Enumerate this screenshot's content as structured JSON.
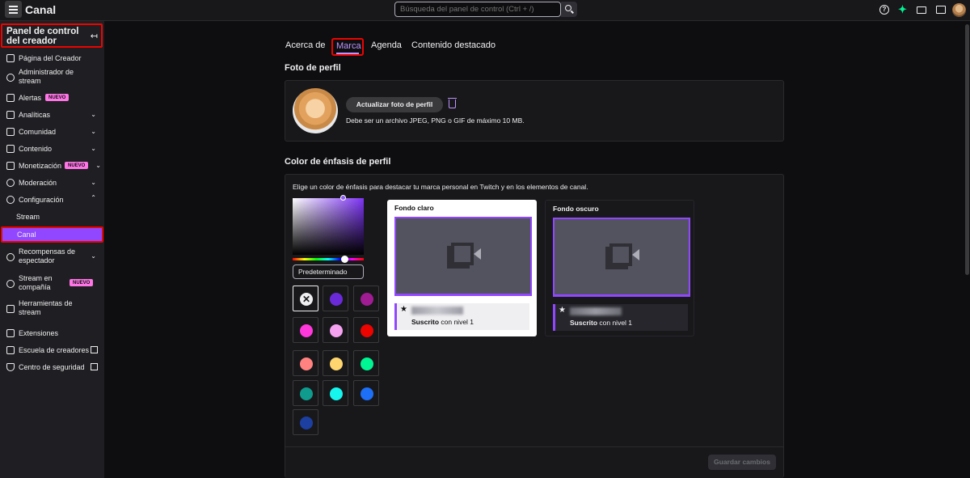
{
  "topbar": {
    "title": "Canal",
    "search_placeholder": "Búsqueda del panel de control (Ctrl + /)",
    "icons": [
      "help-icon",
      "sparkle-icon",
      "inbox-icon",
      "whispers-icon",
      "avatar"
    ]
  },
  "sidebar": {
    "header": "Panel de control del creador",
    "items": [
      {
        "label": "Página del Creador"
      },
      {
        "label": "Administrador de stream"
      },
      {
        "label": "Alertas",
        "badge": "NUEVO"
      },
      {
        "label": "Analíticas"
      },
      {
        "label": "Comunidad"
      },
      {
        "label": "Contenido"
      },
      {
        "label": "Monetización",
        "badge": "NUEVO"
      },
      {
        "label": "Moderación"
      },
      {
        "label": "Configuración"
      },
      {
        "label": "Stream"
      },
      {
        "label": "Canal"
      },
      {
        "label": "Recompensas de espectador"
      },
      {
        "label": "Stream en compañía",
        "badge": "NUEVO"
      },
      {
        "label": "Herramientas de stream"
      },
      {
        "label": "Extensiones"
      },
      {
        "label": "Escuela de creadores"
      },
      {
        "label": "Centro de seguridad"
      }
    ]
  },
  "tabs": [
    "Acerca de",
    "Marca",
    "Agenda",
    "Contenido destacado"
  ],
  "active_tab": "Marca",
  "profile_photo": {
    "title": "Foto de perfil",
    "button": "Actualizar foto de perfil",
    "hint": "Debe ser un archivo JPEG, PNG o GIF de máximo 10 MB."
  },
  "accent": {
    "title": "Color de énfasis de perfil",
    "description": "Elige un color de énfasis para destacar tu marca personal en Twitch y en los elementos de canal.",
    "default_label": "Predeterminado",
    "selected_color": "#7d34f5",
    "swatches": [
      "none",
      "#6b2ad8",
      "#a01c93",
      "#ff38db",
      "#f5a3f0",
      "#eb0400",
      "#ff8280",
      "#fed56e",
      "#00f593",
      "#0f9b8e",
      "#16f5ee",
      "#1d6ff5",
      "#1c3fa0"
    ],
    "light_preview": {
      "title": "Fondo claro",
      "sub_label": "Suscrito",
      "sub_level": "con nivel 1"
    },
    "dark_preview": {
      "title": "Fondo oscuro",
      "sub_label": "Suscrito",
      "sub_level": "con nivel 1"
    },
    "save_button": "Guardar cambios"
  }
}
